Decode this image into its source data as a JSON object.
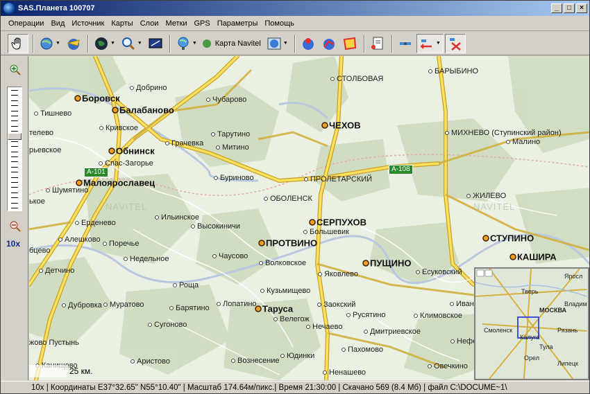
{
  "window": {
    "title": "SAS.Планета 100707",
    "min_label": "_",
    "max_label": "□",
    "close_label": "×"
  },
  "menu": [
    "Операции",
    "Вид",
    "Источник",
    "Карты",
    "Слои",
    "Метки",
    "GPS",
    "Параметры",
    "Помощь"
  ],
  "toolbar": {
    "map_source_label": "Карта Navitel"
  },
  "zoom": {
    "level_label": "10x",
    "level": 10,
    "max": 24
  },
  "map": {
    "cities": [
      {
        "name": "Боровск",
        "big": true
      },
      {
        "name": "Балабаново",
        "big": true
      },
      {
        "name": "Обнинск",
        "big": true
      },
      {
        "name": "Малоярославец",
        "big": true
      },
      {
        "name": "ЧЕХОВ",
        "big": true
      },
      {
        "name": "СЕРПУХОВ",
        "big": true
      },
      {
        "name": "ПРОТВИНО",
        "big": true
      },
      {
        "name": "ПУЩИНО",
        "big": true
      },
      {
        "name": "СТУПИНО",
        "big": true
      },
      {
        "name": "КАШИРА",
        "big": true
      },
      {
        "name": "Таруса",
        "big": true
      },
      {
        "name": "Добрино"
      },
      {
        "name": "Чубарово"
      },
      {
        "name": "СТОЛБОВАЯ"
      },
      {
        "name": "БАРЫБИНО"
      },
      {
        "name": "Тишнево"
      },
      {
        "name": "Кривское"
      },
      {
        "name": "Тарутино"
      },
      {
        "name": "Грачевка"
      },
      {
        "name": "Митино"
      },
      {
        "name": "МИХНЕВО (Ступинский район)"
      },
      {
        "name": "Малино"
      },
      {
        "name": "телево"
      },
      {
        "name": "рьевское"
      },
      {
        "name": "Спас-Загорье"
      },
      {
        "name": "Буриново"
      },
      {
        "name": "ПРОЛЕТАРСКИЙ"
      },
      {
        "name": "Шумятино"
      },
      {
        "name": "ОБОЛЕНСК"
      },
      {
        "name": "ЖИЛЕВО"
      },
      {
        "name": "ькое"
      },
      {
        "name": "Ерденево"
      },
      {
        "name": "Ильинское"
      },
      {
        "name": "Высокиничи"
      },
      {
        "name": "Большевик"
      },
      {
        "name": "Алешково"
      },
      {
        "name": "Поречье"
      },
      {
        "name": "бцево"
      },
      {
        "name": "Недельное"
      },
      {
        "name": "Чаусово"
      },
      {
        "name": "Волковское"
      },
      {
        "name": "Детчино"
      },
      {
        "name": "Яковлево"
      },
      {
        "name": "Есуковский"
      },
      {
        "name": "Роща"
      },
      {
        "name": "Кузьмищево"
      },
      {
        "name": "Дубровка"
      },
      {
        "name": "Муратово"
      },
      {
        "name": "Барятино"
      },
      {
        "name": "Лопатино"
      },
      {
        "name": "Заокский"
      },
      {
        "name": "Иван"
      },
      {
        "name": "Русятино"
      },
      {
        "name": "Климовское"
      },
      {
        "name": "Велегож"
      },
      {
        "name": "Сугоново"
      },
      {
        "name": "Нечаево"
      },
      {
        "name": "Дмитриевское"
      },
      {
        "name": "Нефе"
      },
      {
        "name": "жово Пустынь"
      },
      {
        "name": "Пахомово"
      },
      {
        "name": "Юдинки"
      },
      {
        "name": "Канищево"
      },
      {
        "name": "Аристово"
      },
      {
        "name": "Вознесение"
      },
      {
        "name": "Ненашево"
      },
      {
        "name": "Овечкино"
      }
    ],
    "roads": [
      "A-101",
      "A-108"
    ],
    "watermark": "NAVITEL",
    "scale_label": "25 км."
  },
  "minimap": {
    "labels": [
      "Тверь",
      "Яросл",
      "Владим",
      "МОСКВА",
      "Рязань",
      "Смоленск",
      "Калуга",
      "Тула",
      "Орел",
      "Липецк"
    ]
  },
  "status": {
    "text": "10x | Координаты E37°32.65\" N55°10.40\" | Масштаб 174.64м/пикс.| Время 21:30:00 | Скачано 569 (8.4 Мб) | файл C:\\DOCUME~1\\"
  }
}
